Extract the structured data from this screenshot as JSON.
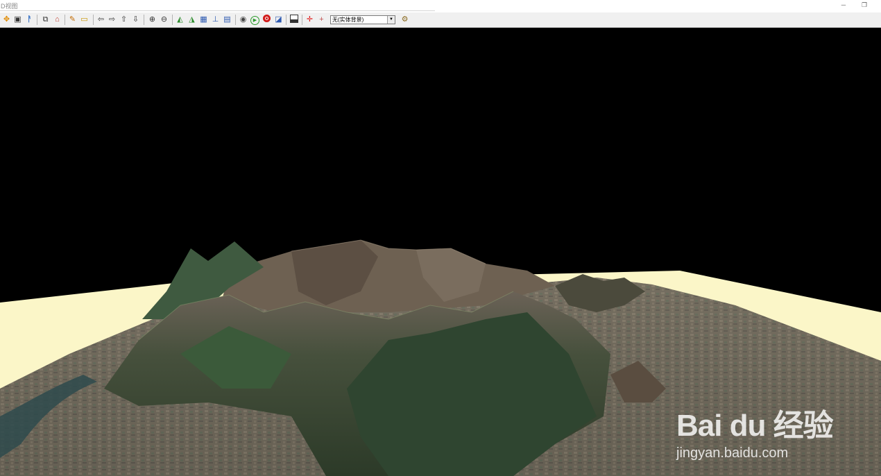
{
  "window": {
    "title": "D视图"
  },
  "toolbar": {
    "buttons": [
      {
        "name": "pan-icon",
        "glyph": "✥",
        "color": "#e08a00"
      },
      {
        "name": "layer-icon",
        "glyph": "▣",
        "color": "#333"
      },
      {
        "name": "walk-icon",
        "glyph": "🚶",
        "color": "#1b5fbf"
      },
      {
        "name": "copy-icon",
        "glyph": "⧉",
        "color": "#333"
      },
      {
        "name": "home-icon",
        "glyph": "⌂",
        "color": "#c0392b"
      },
      {
        "name": "draw-icon",
        "glyph": "✎",
        "color": "#c26a00"
      },
      {
        "name": "ruler-icon",
        "glyph": "▭",
        "color": "#c79400"
      },
      {
        "name": "arrow-left-icon",
        "glyph": "⇦",
        "color": "#333"
      },
      {
        "name": "arrow-right-icon",
        "glyph": "⇨",
        "color": "#333"
      },
      {
        "name": "arrow-up-icon",
        "glyph": "⇧",
        "color": "#333"
      },
      {
        "name": "arrow-down-icon",
        "glyph": "⇩",
        "color": "#333"
      },
      {
        "name": "zoom-in-icon",
        "glyph": "⊕",
        "color": "#333"
      },
      {
        "name": "zoom-out-icon",
        "glyph": "⊖",
        "color": "#333"
      },
      {
        "name": "terrain-icon",
        "glyph": "◭",
        "color": "#2a8a2a"
      },
      {
        "name": "terrain-edit-icon",
        "glyph": "◮",
        "color": "#2a8a2a"
      },
      {
        "name": "grid-icon",
        "glyph": "▦",
        "color": "#2c58b0"
      },
      {
        "name": "elevation-icon",
        "glyph": "⊥",
        "color": "#2c58b0"
      },
      {
        "name": "chart-icon",
        "glyph": "▤",
        "color": "#2c58b0"
      },
      {
        "name": "camera-icon",
        "glyph": "◉",
        "color": "#444"
      },
      {
        "name": "play-icon",
        "glyph": "▶",
        "color": "#2a9a2a"
      },
      {
        "name": "stop-icon",
        "glyph": "●",
        "color": "#d11b1b"
      },
      {
        "name": "export-icon",
        "glyph": "◪",
        "color": "#2c58b0"
      },
      {
        "name": "save-icon",
        "glyph": "▪",
        "color": "#333"
      },
      {
        "name": "crosshair-red-icon",
        "glyph": "✛",
        "color": "#e01010"
      },
      {
        "name": "crosshair-icon",
        "glyph": "+",
        "color": "#c05050"
      },
      {
        "name": "settings-icon",
        "glyph": "⚙",
        "color": "#8a6a20"
      }
    ],
    "background_select": {
      "value": "无(实体背景)",
      "arrow": "▼"
    }
  },
  "colors": {
    "sky": "#000000",
    "ground_plane": "#fbf6c8",
    "toolbar_bg": "#f0f0f0"
  },
  "watermark": {
    "brand": "Bai du 经验",
    "url": "jingyan.baidu.com"
  }
}
